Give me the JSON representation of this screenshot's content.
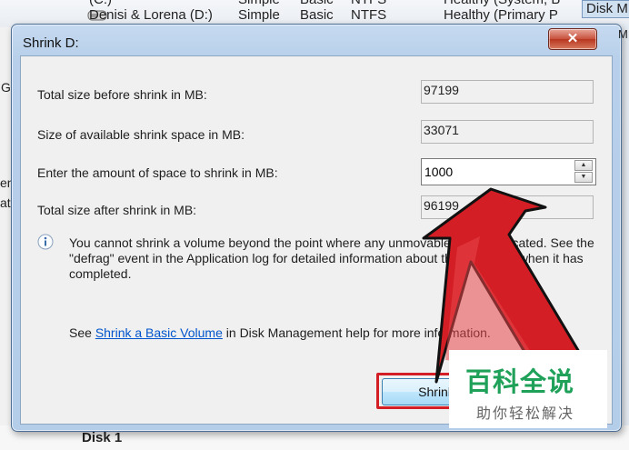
{
  "background": {
    "volume_row_cut": "(C:)",
    "volume_row_cut_cols": [
      "Simple",
      "Basic",
      "NTFS",
      "Healthy (System, B"
    ],
    "volume_row": {
      "name": "Denisi & Lorena (D:)",
      "layout": "Simple",
      "type": "Basic",
      "file_system": "NTFS",
      "status": "Healthy (Primary P"
    },
    "disk_panel_label": "Disk M",
    "right_fragment": "M",
    "left_fragments": [
      "G",
      "en",
      "at"
    ],
    "disk1_label": "Disk 1"
  },
  "dialog": {
    "title": "Shrink D:",
    "close_glyph": "✕",
    "fields": {
      "total_before_label": "Total size before shrink in MB:",
      "total_before_value": "97199",
      "available_label": "Size of available shrink space in MB:",
      "available_value": "33071",
      "amount_label": "Enter the amount of space to shrink in MB:",
      "amount_value": "1000",
      "total_after_label": "Total size after shrink in MB:",
      "total_after_value": "96199"
    },
    "info_message": "You cannot shrink a volume beyond the point where any unmovable files are located. See the \"defrag\" event in the Application log for detailed information about the operation when it has completed.",
    "help": {
      "prefix": "See ",
      "link": "Shrink a Basic Volume",
      "suffix": " in Disk Management help for more information."
    },
    "shrink_button_label": "Shrink"
  },
  "watermark": {
    "main": "百科全说",
    "sub": "助你轻松解决"
  },
  "colors": {
    "dialog_frame": "#b7cfea",
    "close_button": "#c7503c",
    "link": "#0055cc",
    "highlight_box": "#d21e24",
    "arrow_fill": "#d21e24",
    "watermark_green": "#1fa15a"
  },
  "icons": {
    "info": "info-icon",
    "spin_up": "chevron-up-icon",
    "spin_down": "chevron-down-icon",
    "close": "close-icon",
    "drive": "drive-icon",
    "pointer_arrow": "arrow-annotation"
  }
}
